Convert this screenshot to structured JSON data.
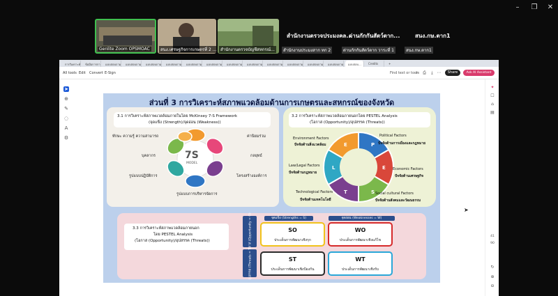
{
  "meeting": {
    "tiles": [
      {
        "name": "Genlite Zoom OPSMOAC"
      },
      {
        "name": "สนง.เศรษฐกิจการเกษตรที่ 2 ..."
      },
      {
        "name": "สำนักงานตรวจบัญชีสหกรณ์..."
      },
      {
        "big": "สำนักงานตรวจประมงคล...",
        "small": "สำนักงานประมงสาก ทก 2"
      },
      {
        "big": "ด่านกักกันสัตว์ตาก...",
        "small": "ด่านกักกันสัตว์ตาก วาระที่ 1"
      },
      {
        "big": "สนง.กษ.ตาก1",
        "small": "สนง.กษ.ตาก1"
      }
    ]
  },
  "browser": {
    "tabs": [
      "การวิเคราะห์สภาพแวดล้อม",
      "ข้อมือการการประ...",
      "แบบสอบถามงาน...",
      "แบบสอบถามงาน...",
      "แบบสอบถามงาน...",
      "แบบสอบถามงาน...",
      "แบบสอบถามงาน...",
      "แบบสอบถามงาน...",
      "แบบสอบถามงาน...",
      "แบบสอบถามงาน...",
      "แบบสอบถามงาน...",
      "แบบสอบถามงาน...",
      "แบบสอบถามงาน...",
      "แบบสอบถามงาน...",
      "แบบสอบ...",
      "Credits"
    ],
    "active_tab": 14,
    "new_tab": "+",
    "menus": [
      "All tools",
      "Edit",
      "Convert",
      "E-Sign"
    ],
    "find_label": "Find text or tools",
    "share_label": "Share",
    "ask_label": "Ask AI Assistant",
    "page_numbers": [
      "41",
      "90"
    ]
  },
  "slide": {
    "title": "ส่วนที่ 3 การวิเคราะห์สภาพแวดล้อมด้านการเกษตรและสหกรณ์ของจังหวัด",
    "left_heading1": "3.1 การวิเคราะห์สภาพแวดล้อมภายในโดย McKinsey 7-S Framework",
    "left_heading2": "(จุดแข็ง (Strength)/จุดอ่อน (Weakness))",
    "center_big": "7S",
    "center_small": "MODEL",
    "labels_left": [
      "ทักษะ ความรู้ ความสามารถ",
      "บุคลากร",
      "รูปแบบปฏิบัติการ"
    ],
    "labels_right": [
      "ค่านิยมร่วม",
      "กลยุทธ์",
      "โครงสร้างองค์การ"
    ],
    "label_bottom": "รูปแบบการบริหารจัดการ",
    "right_heading1": "3.2 การวิเคราะห์สภาพแวดล้อมภายนอกโดย PESTEL Analysis",
    "right_heading2": "(โอกาส (Opportunity)/อุปสรรค (Threats))",
    "pestel": [
      {
        "en": "Environment Factors",
        "th": "ปัจจัยด้านสิ่งแวดล้อม"
      },
      {
        "en": "Political Factors",
        "th": "ปัจจัยด้านการเมืองและกฎหมาย"
      },
      {
        "en": "Economic Factors",
        "th": "ปัจจัยด้านเศรษฐกิจ"
      },
      {
        "en": "Social cultural Factors",
        "th": "ปัจจัยด้านสังคมและวัฒนธรรม"
      },
      {
        "en": "Technological Factors",
        "th": "ปัจจัยด้านเทคโนโลยี"
      },
      {
        "en": "Law/Legal Factors",
        "th": "ปัจจัยด้านกฎหมาย"
      }
    ],
    "pestel_letters": [
      "E",
      "P",
      "E",
      "S",
      "T",
      "L"
    ],
    "bottom_heading1": "3.3 การวิเคราะห์สภาพแวดล้อมภายนอก",
    "bottom_heading2": "โดย PESTEL Analysis",
    "bottom_heading3": "(โอกาส (Opportunity)/อุปสรรค (Threats))",
    "col_strength": "จุดแข็ง (Strengths = S)",
    "col_weakness": "จุดอ่อน (Weaknesses = W)",
    "row_opportunity": "โอกาส (Opportunity = O)",
    "row_threat": "อุปสรรค (Threats = T)",
    "swot": [
      {
        "code": "SO",
        "desc": "ประเด็นการพัฒนาเชิงรุก"
      },
      {
        "code": "WO",
        "desc": "ประเด็นการพัฒนาเชิงแก้ไข"
      },
      {
        "code": "ST",
        "desc": "ประเด็นการพัฒนาเชิงป้องกัน"
      },
      {
        "code": "WT",
        "desc": "ประเด็นการพัฒนาเชิงรับ"
      }
    ]
  },
  "colors": {
    "petal_orange": "#f29a2e",
    "petal_pink": "#e7477a",
    "petal_green": "#7bb84b",
    "petal_teal": "#2fa7a0",
    "petal_blue": "#2f76c4",
    "petal_purple": "#7a3f8f",
    "swot_yellow": "#f1c21b",
    "swot_red": "#d62a2a",
    "swot_dark": "#2b2b2b",
    "swot_cyan": "#2aa7d8"
  }
}
